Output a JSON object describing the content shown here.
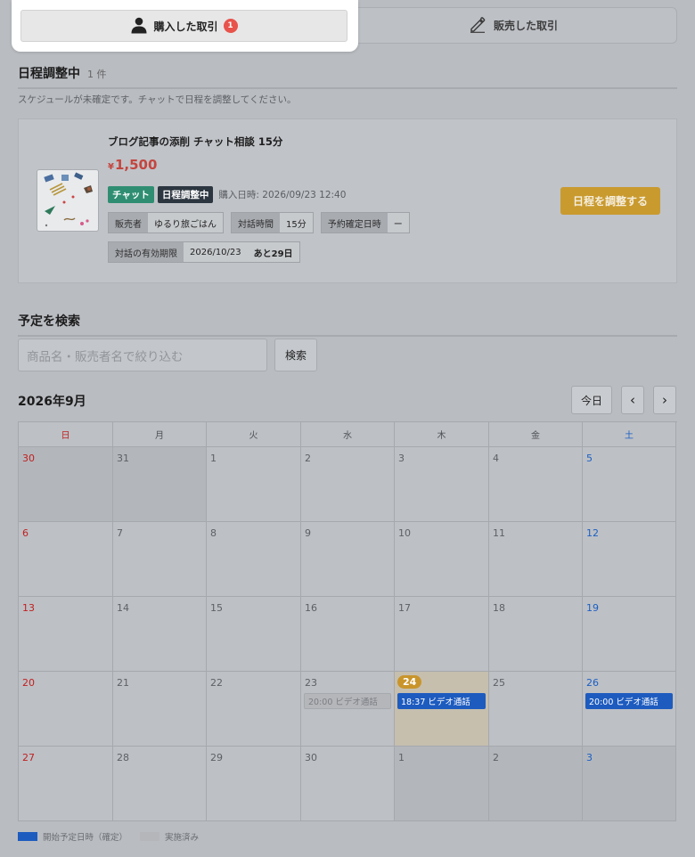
{
  "tabs": {
    "bought_label": "購入した取引",
    "bought_count": "1",
    "sold_label": "販売した取引"
  },
  "pending": {
    "title": "日程調整中",
    "count": "1 件",
    "note": "スケジュールが未確定です。チャットで日程を調整してください。"
  },
  "order": {
    "title": "ブログ記事の添削 チャット相談 15分",
    "price_symbol": "¥",
    "price": "1,500",
    "tag_chat": "チャット",
    "tag_status": "日程調整中",
    "purchase_date": "購入日時: 2026/09/23 12:40",
    "seller_label": "販売者",
    "seller_value": "ゆるり旅ごはん",
    "duration_label": "対話時間",
    "duration_value": "15分",
    "confirmed_label": "予約確定日時",
    "confirmed_value": "ー",
    "expiry_label": "対話の有効期限",
    "expiry_value": "2026/10/23",
    "expiry_remaining": "あと29日",
    "schedule_button": "日程を調整する"
  },
  "search": {
    "title": "予定を検索",
    "placeholder": "商品名・販売者名で絞り込む",
    "button": "検索"
  },
  "calendar": {
    "month": "2026年9月",
    "today_button": "今日",
    "prev": "‹",
    "next": "›",
    "weekdays": [
      "日",
      "月",
      "火",
      "水",
      "木",
      "金",
      "土"
    ],
    "weeks": [
      [
        "30",
        "31",
        "1",
        "2",
        "3",
        "4",
        "5"
      ],
      [
        "6",
        "7",
        "8",
        "9",
        "10",
        "11",
        "12"
      ],
      [
        "13",
        "14",
        "15",
        "16",
        "17",
        "18",
        "19"
      ],
      [
        "20",
        "21",
        "22",
        "23",
        "24",
        "25",
        "26"
      ],
      [
        "27",
        "28",
        "29",
        "30",
        "1",
        "2",
        "3"
      ]
    ],
    "events": {
      "w3d3": "20:00 ビデオ通話",
      "w3d4": "18:37 ビデオ通話",
      "w3d6": "20:00 ビデオ通話"
    }
  },
  "legend": {
    "confirmed": "開始予定日時（確定）",
    "done": "実施済み"
  },
  "colors": {
    "accent_gold": "#c99a2e",
    "event_blue": "#1d5bbf",
    "sunday_red": "#c02020",
    "saturday_blue": "#1c5fc4",
    "badge_red": "#e8534b"
  }
}
